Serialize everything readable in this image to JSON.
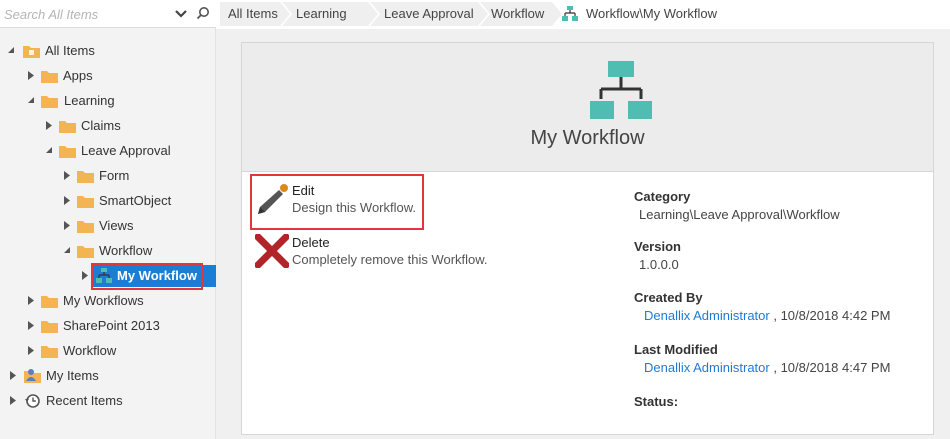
{
  "search": {
    "placeholder": "Search All Items"
  },
  "tree": {
    "all_items": "All Items",
    "apps": "Apps",
    "learning": "Learning",
    "claims": "Claims",
    "leave_approval": "Leave Approval",
    "form": "Form",
    "smartobject": "SmartObject",
    "views": "Views",
    "workflow": "Workflow",
    "my_workflow": "My Workflow",
    "my_workflows": "My Workflows",
    "sharepoint_2013": "SharePoint 2013",
    "workflow_root": "Workflow",
    "my_items": "My Items",
    "recent_items": "Recent Items"
  },
  "breadcrumb": [
    "All Items",
    "Learning",
    "Leave Approval",
    "Workflow"
  ],
  "breadcrumb_current": "Workflow\\My Workflow",
  "card": {
    "title": "My Workflow",
    "actions": {
      "edit": {
        "title": "Edit",
        "desc": "Design this Workflow."
      },
      "delete": {
        "title": "Delete",
        "desc": "Completely remove this Workflow."
      }
    },
    "properties": {
      "category_label": "Category",
      "category_value": "Learning\\Leave Approval\\Workflow",
      "version_label": "Version",
      "version_value": "1.0.0.0",
      "created_label": "Created By",
      "created_user": "Denallix Administrator",
      "created_date": ", 10/8/2018 4:42 PM",
      "modified_label": "Last Modified",
      "modified_user": "Denallix Administrator",
      "modified_date": ", 10/8/2018 4:47 PM",
      "status_label": "Status:"
    }
  },
  "colors": {
    "accent_blue": "#1a7fd4",
    "link_blue": "#1f7ad4",
    "highlight_red": "#e2363a",
    "workflow_teal": "#4fbdb1",
    "folder_orange": "#f5b453",
    "delete_red": "#b0242a"
  },
  "icons": [
    "search-icon",
    "chevron-down-icon",
    "folder-icon",
    "workflow-icon",
    "pencil-icon",
    "delete-x-icon",
    "user-icon",
    "clock-icon"
  ]
}
